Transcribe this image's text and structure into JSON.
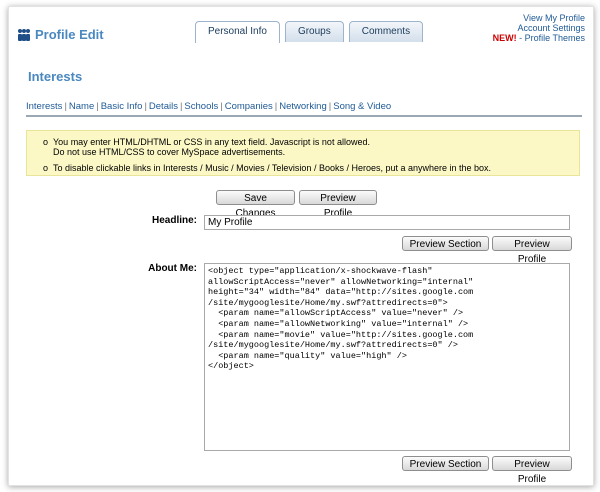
{
  "header": {
    "title": "Profile Edit",
    "tabs": [
      "Personal Info",
      "Groups",
      "Comments"
    ],
    "active_tab": "Personal Info",
    "links": {
      "view_profile": "View My Profile",
      "account_settings": "Account Settings",
      "new_badge": "NEW!",
      "themes": "- Profile Themes"
    }
  },
  "section": {
    "title": "Interests",
    "nav": [
      "Interests",
      "Name",
      "Basic Info",
      "Details",
      "Schools",
      "Companies",
      "Networking",
      "Song & Video"
    ]
  },
  "notice": {
    "line1a": "You may enter HTML/DHTML or CSS in any text field. Javascript is not allowed.",
    "line1b": "Do not use HTML/CSS to cover MySpace advertisements.",
    "line2": "To disable clickable links in Interests / Music / Movies / Television / Books / Heroes, put a anywhere in the box."
  },
  "buttons": {
    "save_changes": "Save Changes",
    "preview_profile": "Preview Profile",
    "preview_section": "Preview Section"
  },
  "form": {
    "headline_label": "Headline:",
    "headline_value": "My Profile",
    "about_label": "About Me:",
    "about_lines": [
      "<object type=\"application/x-shockwave-flash\"",
      "allowScriptAccess=\"never\" allowNetworking=\"internal\"",
      "height=\"34\" width=\"84\" data=\"http://sites.google.com",
      "/site/mygooglesite/Home/my.swf?attredirects=0\">",
      "  <param name=\"allowScriptAccess\" value=\"never\" />",
      "  <param name=\"allowNetworking\" value=\"internal\" />",
      "  <param name=\"movie\" value=\"http://sites.google.com",
      "/site/mygooglesite/Home/my.swf?attredirects=0\" />",
      "  <param name=\"quality\" value=\"high\" />",
      "</object>"
    ]
  },
  "colors": {
    "accent": "#4a88c0",
    "link": "#1f5a96",
    "notice_bg": "#fbf8c6",
    "new_red": "#cc0000"
  }
}
